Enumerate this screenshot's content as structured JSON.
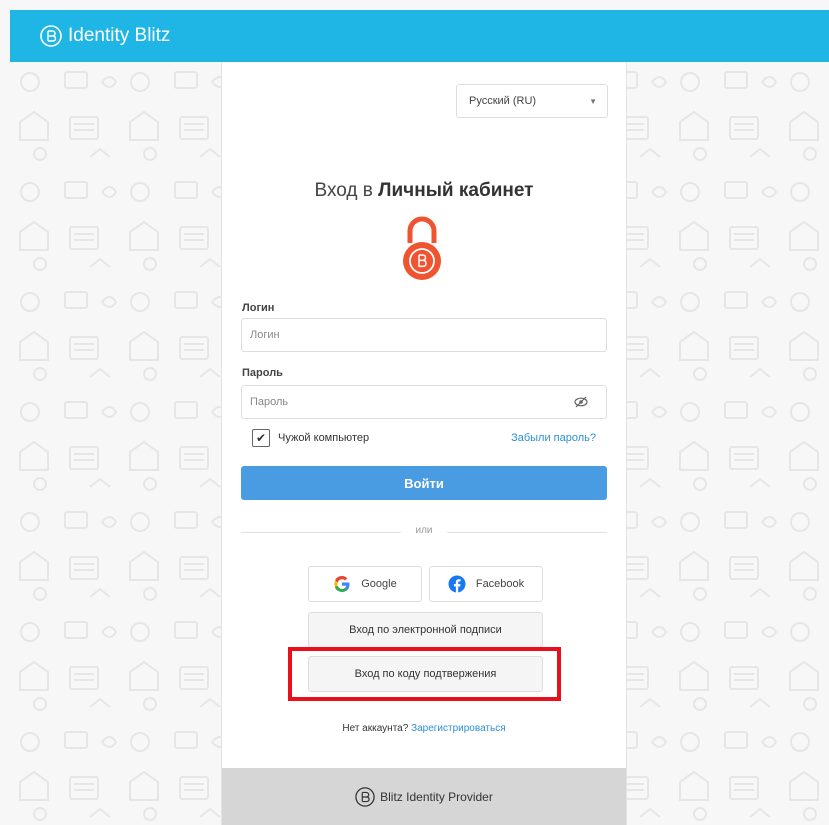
{
  "header": {
    "brand": "Identity Blitz"
  },
  "language": {
    "selected": "Русский (RU)"
  },
  "login": {
    "title_prefix": "Вход в",
    "title_bold": "Личный кабинет",
    "login_label": "Логин",
    "login_placeholder": "Логин",
    "password_label": "Пароль",
    "password_placeholder": "Пароль",
    "foreign_computer_label": "Чужой компьютер",
    "foreign_computer_checked": true,
    "forgot_password": "Забыли пароль?",
    "submit_label": "Войти"
  },
  "alternatives": {
    "divider_text": "или",
    "google_label": "Google",
    "facebook_label": "Facebook",
    "esign_label": "Вход по электронной подписи",
    "code_label": "Вход по коду подтвержения"
  },
  "signup": {
    "prompt": "Нет аккаунта?",
    "link": "Зарегистрироваться"
  },
  "footer": {
    "brand": "Blitz Identity Provider"
  },
  "colors": {
    "topbar": "#1fb6e6",
    "primary_button": "#4a9ce2",
    "link": "#2d8fd6",
    "lock": "#f0532f",
    "highlight": "#e8101c",
    "footer": "#d6d6d6"
  },
  "icons": [
    "blitz-logo-icon",
    "chevron-down-icon",
    "lock-icon",
    "eye-slash-icon",
    "checkmark-icon",
    "google-icon",
    "facebook-icon"
  ]
}
